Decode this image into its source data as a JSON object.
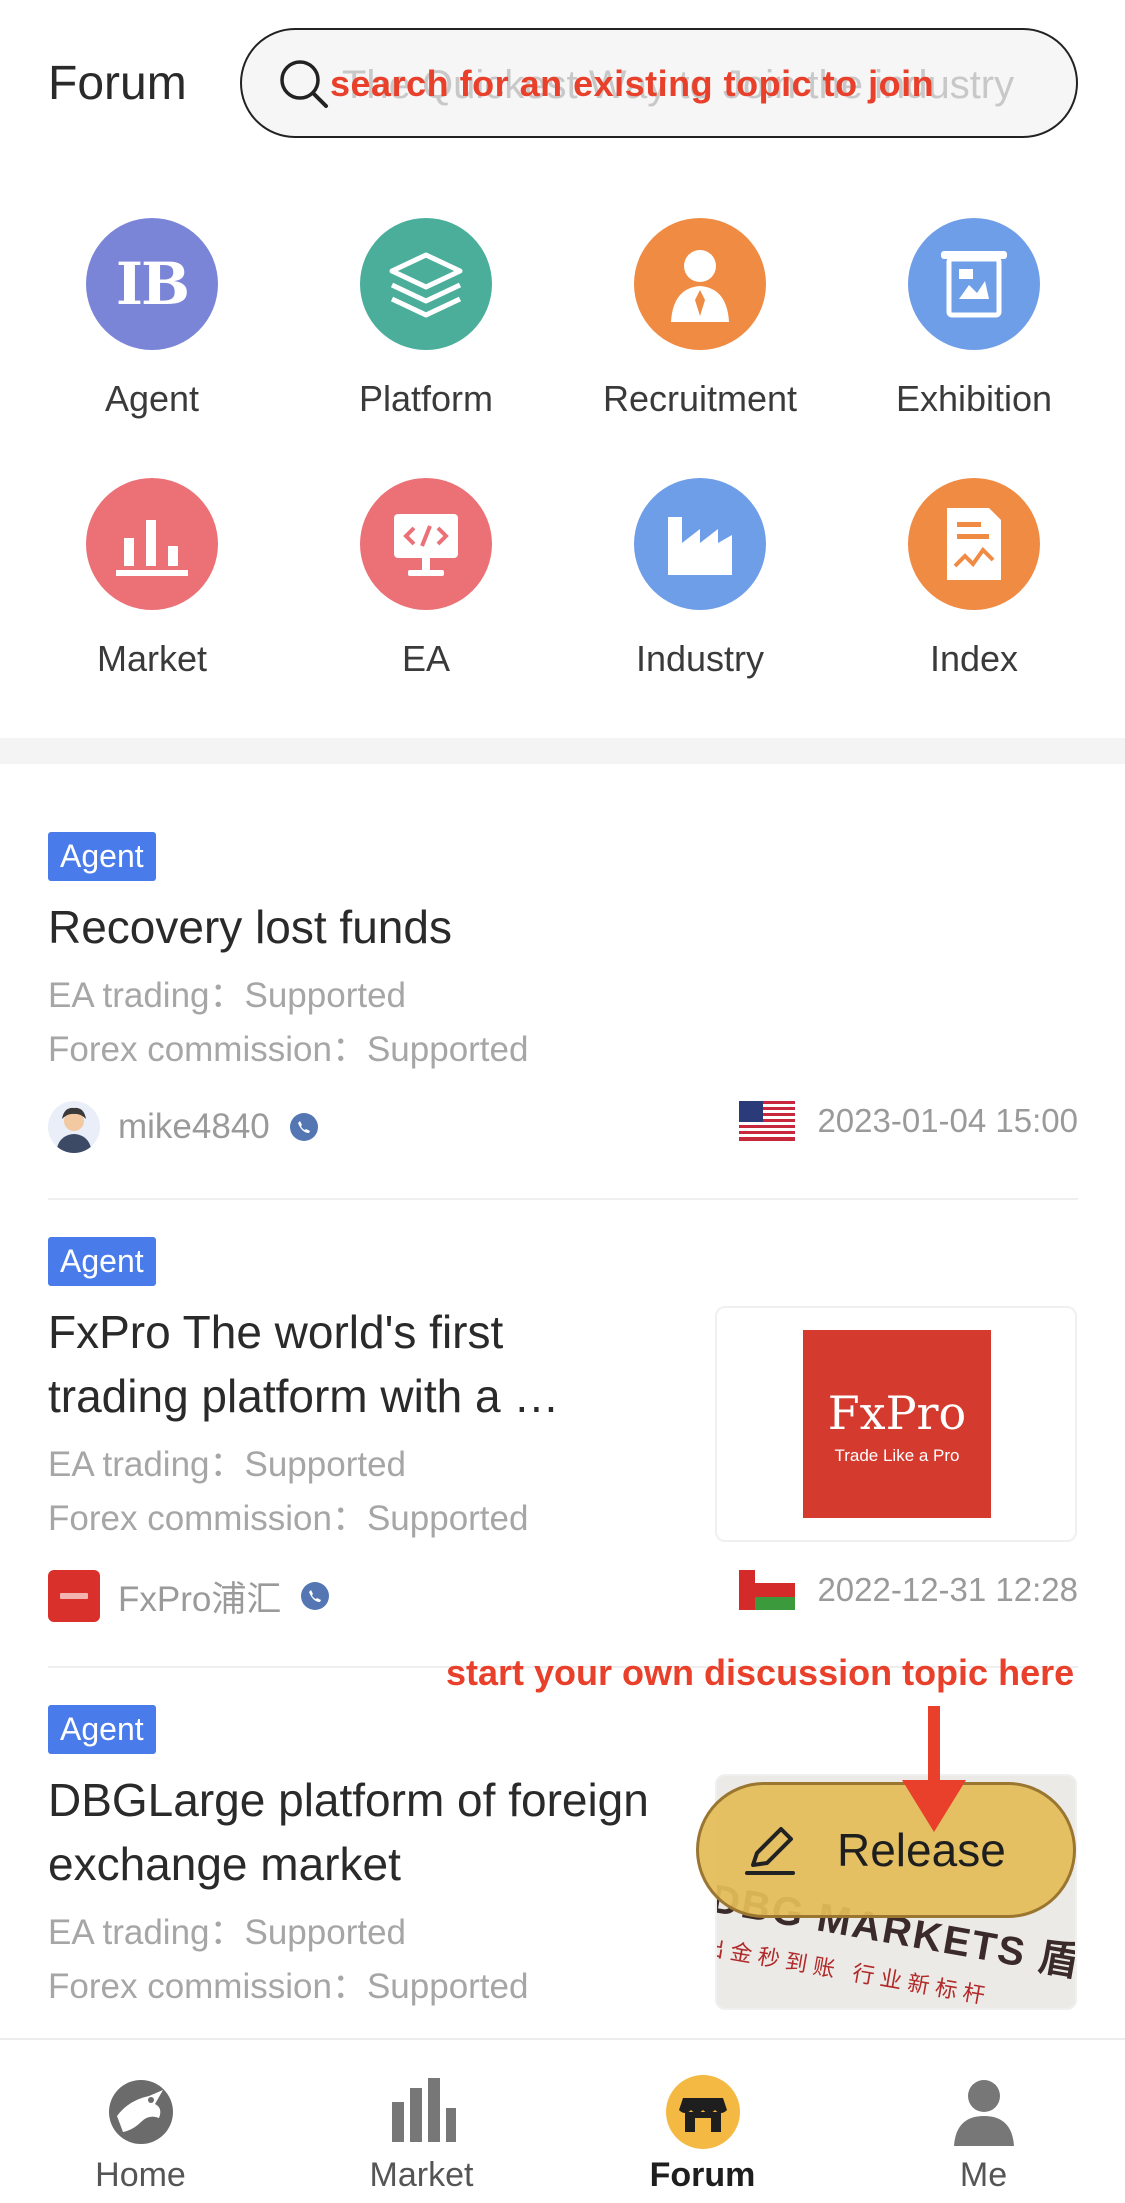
{
  "header": {
    "title": "Forum",
    "search_placeholder": "The Quickest Way to Join the industry",
    "search_annotation": "search for an existing topic to join"
  },
  "categories": [
    {
      "label": "Agent",
      "color": "#7b85d8",
      "icon": "ib-icon"
    },
    {
      "label": "Platform",
      "color": "#4aae9b",
      "icon": "layers-icon"
    },
    {
      "label": "Recruitment",
      "color": "#f08b44",
      "icon": "person-icon"
    },
    {
      "label": "Exhibition",
      "color": "#6f9ee8",
      "icon": "exhibition-icon"
    },
    {
      "label": "Market",
      "color": "#ec7177",
      "icon": "bar-chart-icon"
    },
    {
      "label": "EA",
      "color": "#ec7177",
      "icon": "code-monitor-icon"
    },
    {
      "label": "Industry",
      "color": "#6f9ee8",
      "icon": "factory-icon"
    },
    {
      "label": "Index",
      "color": "#f08b44",
      "icon": "document-chart-icon"
    }
  ],
  "posts": [
    {
      "tag": "Agent",
      "title": "Recovery lost funds",
      "ea_trading": "EA trading：Supported",
      "forex_commission": "Forex commission：Supported",
      "author": "mike4840",
      "date": "2023-01-04 15:00",
      "flag": "us-flag-icon"
    },
    {
      "tag": "Agent",
      "title": "FxPro The world's first trading platform with a …",
      "ea_trading": "EA trading：Supported",
      "forex_commission": "Forex commission：Supported",
      "author": "FxPro浦汇",
      "date": "2022-12-31 12:28",
      "flag": "oman-flag-icon",
      "thumb": {
        "brand": "FxPro",
        "tagline": "Trade Like a Pro"
      }
    },
    {
      "tag": "Agent",
      "title": "DBGLarge platform of foreign exchange market",
      "ea_trading": "EA trading：Supported",
      "forex_commission": "Forex commission：Supported",
      "thumb": {
        "brand": "DBG MARKETS 盾博",
        "tagline": "出金秒到账 行业新标杆"
      }
    }
  ],
  "release": {
    "label": "Release",
    "annotation": "start your own discussion topic here"
  },
  "bottom_nav": [
    {
      "label": "Home",
      "icon": "eagle-icon",
      "active": false
    },
    {
      "label": "Market",
      "icon": "bar-chart-icon",
      "active": false
    },
    {
      "label": "Forum",
      "icon": "store-icon",
      "active": true
    },
    {
      "label": "Me",
      "icon": "person-icon",
      "active": false
    }
  ],
  "colors": {
    "tag_blue": "#4a7bea",
    "annotation_red": "#e8402a",
    "release_gold": "#e4bc58",
    "forum_active": "#f4b942"
  }
}
